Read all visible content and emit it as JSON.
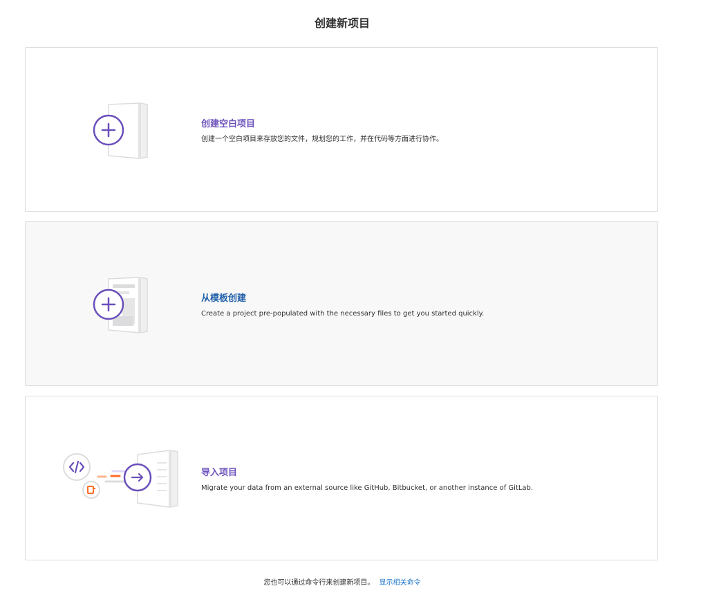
{
  "page": {
    "title": "创建新项目"
  },
  "cards": [
    {
      "title": "创建空白项目",
      "description": "创建一个空白项目来存放您的文件，规划您的工作，并在代码等方面进行协作。",
      "icon": "plus-circle-icon"
    },
    {
      "title": "从模板创建",
      "description": "Create a project pre-populated with the necessary files to get you started quickly.",
      "icon": "plus-circle-icon"
    },
    {
      "title": "导入项目",
      "description": "Migrate your data from an external source like GitHub, Bitbucket, or another instance of GitLab.",
      "icon": "arrow-right-circle-icon"
    }
  ],
  "footer": {
    "note": "您也可以通过命令行来创建新项目。",
    "link_label": "显示相关命令"
  },
  "colors": {
    "accent_purple": "#6b4fbb",
    "link_blue": "#1f75cb",
    "hover_title_blue": "#1f5fa8",
    "card_border": "#dcdcde",
    "hover_background": "#f8f8f8",
    "orange_accent": "#fc6d26"
  }
}
